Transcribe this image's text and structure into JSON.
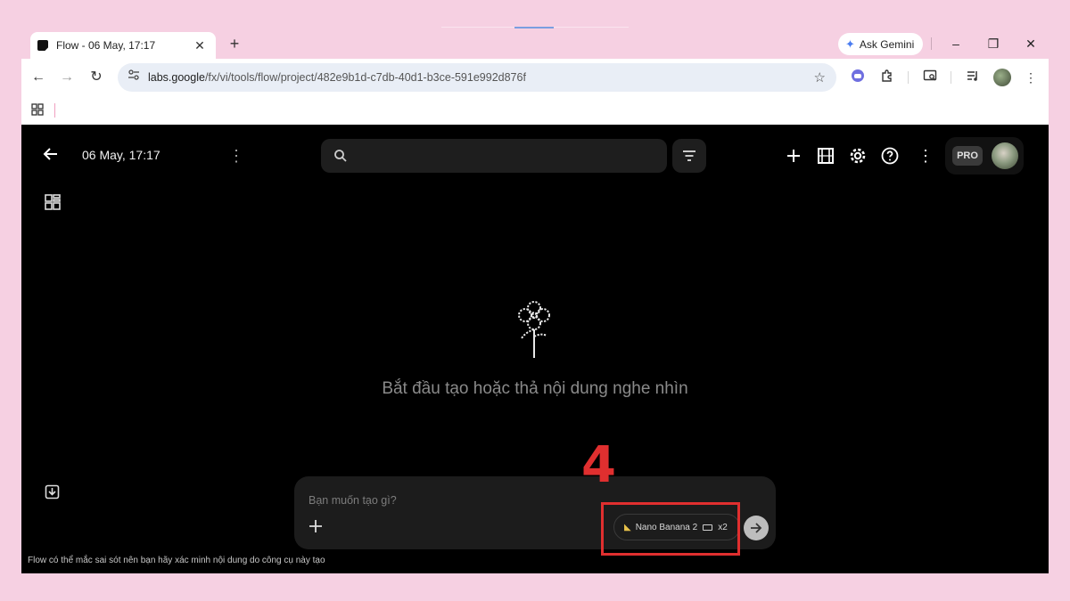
{
  "browser": {
    "tab": {
      "title": "Flow - 06 May, 17:17",
      "close_glyph": "✕"
    },
    "new_tab_glyph": "+",
    "gemini_button": "Ask Gemini",
    "window_controls": {
      "minimize": "–",
      "restore": "❐",
      "close": "✕"
    },
    "nav": {
      "back": "←",
      "forward": "→",
      "reload": "↻"
    },
    "url": {
      "host": "labs.google",
      "path": "/fx/vi/tools/flow/project/482e9b1d-c7db-40d1-b3ce-591e992d876f"
    },
    "bookmark_star": "☆"
  },
  "app": {
    "project_title": "06 May, 17:17",
    "search": {
      "placeholder": ""
    },
    "pro_badge": "PRO",
    "empty_state": "Bắt đầu tạo hoặc thả nội dung nghe nhìn",
    "prompt": {
      "placeholder": "Bạn muốn tạo gì?",
      "model_name": "Nano Banana 2",
      "count": "x2"
    },
    "footer_note": "Flow có thể mắc sai sót nên bạn hãy xác minh nội dung do công cụ này tạo"
  },
  "annotation": {
    "step_number": "4",
    "color": "#e02f2f"
  },
  "colors": {
    "page_bg": "#f6d0e2",
    "app_bg": "#000000",
    "panel": "#1c1c1c"
  }
}
